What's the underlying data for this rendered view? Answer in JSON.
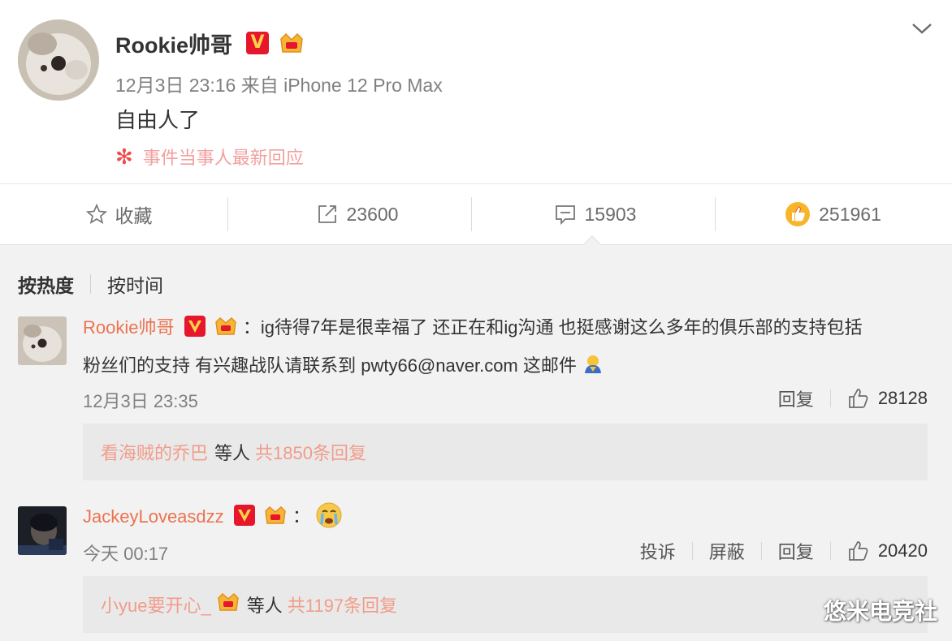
{
  "post": {
    "author": "Rookie帅哥",
    "meta": "12月3日 23:16 来自 iPhone 12 Pro Max",
    "text": "自由人了",
    "topic": "事件当事人最新回应"
  },
  "actions": {
    "favorite_label": "收藏",
    "repost_count": "23600",
    "comment_count": "15903",
    "like_count": "251961"
  },
  "sort": {
    "hot": "按热度",
    "time": "按时间"
  },
  "comments": [
    {
      "author": "Rookie帅哥",
      "text_line1": "：ig待得7年是很幸福了 还正在和ig沟通 也挺感谢这么多年的俱乐部的支持包括",
      "text_line2": "粉丝们的支持  有兴趣战队请联系到 pwty66@naver.com 这邮件",
      "time": "12月3日 23:35",
      "reply_label": "回复",
      "likes": "28128",
      "replies": {
        "names": "看海贼的乔巴",
        "etc": "等人",
        "count": "共1850条回复"
      }
    },
    {
      "author": "JackeyLoveasdzz",
      "text_line1": "：",
      "time": "今天 00:17",
      "report_label": "投诉",
      "block_label": "屏蔽",
      "reply_label": "回复",
      "likes": "20420",
      "replies": {
        "names": "小yue要开心_",
        "etc": "等人",
        "count": "共1197条回复"
      }
    }
  ],
  "watermark": "悠米电竞社",
  "colors": {
    "accent": "#eb7350",
    "vbadge": "#e6162d",
    "link_light": "#f19c8a"
  }
}
